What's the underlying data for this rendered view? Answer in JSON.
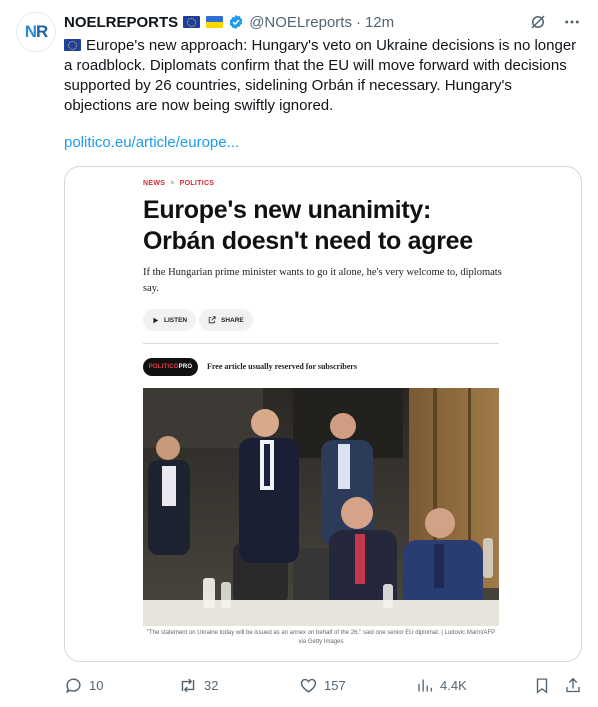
{
  "tweet": {
    "avatar_text_a": "N",
    "avatar_text_b": "R",
    "display_name": "NOELREPORTS",
    "handle": "@NOELreports",
    "separator": "·",
    "time": "12m",
    "text_line1": "Europe's new approach: Hungary's veto on Ukraine decisions is no longer a roadblock. Diplomats confirm that the EU will move forward with decisions supported by 26 countries, sidelining Orbán if necessary. Hungary's objections are now being swiftly ignored.",
    "link_text": "politico.eu/article/europe...",
    "icons": [
      "grok-icon",
      "more-icon"
    ]
  },
  "card": {
    "crumb_news": "NEWS",
    "crumb_sep": ">",
    "crumb_section": "POLITICS",
    "headline": "Europe's new unanimity: Orbán doesn't need to agree",
    "subhead": "If the Hungarian prime minister wants to go it alone, he's very welcome to, diplomats say.",
    "listen_label": "LISTEN",
    "share_label": "SHARE",
    "pro_badge_a": "POLITICO",
    "pro_badge_b": "PRO",
    "free_note": "Free article usually reserved for subscribers",
    "caption": "\"The statement on Ukraine today will be issued as an annex on behalf of the 26,\" said one senior EU diplomat. | Ludovic Marin/AFP via Getty Images"
  },
  "actions": {
    "replies": "10",
    "reposts": "32",
    "likes": "157",
    "views": "4.4K"
  },
  "colors": {
    "link": "#1d9bf0",
    "verified": "#1d9bf0",
    "secondary_text": "#536471",
    "politico_red": "#d5272f"
  }
}
